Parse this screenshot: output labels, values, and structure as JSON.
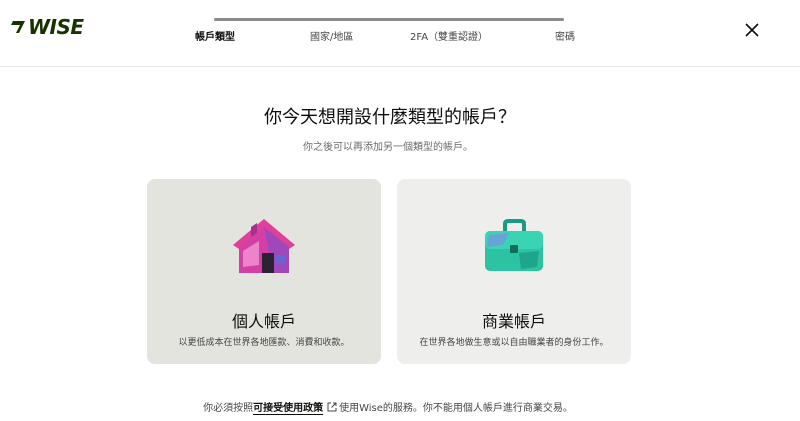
{
  "header": {
    "logo_text": "WISE",
    "steps": [
      {
        "label": "帳戶類型",
        "active": true
      },
      {
        "label": "國家/地區",
        "active": false
      },
      {
        "label": "2FA（雙重認證）",
        "active": false
      },
      {
        "label": "密碼",
        "active": false
      }
    ],
    "close_icon": "close-icon"
  },
  "main": {
    "title": "你今天想開設什麼類型的帳戶？",
    "subtitle": "你之後可以再添加另一個類型的帳戶。",
    "cards": [
      {
        "title": "個人帳戶",
        "description": "以更低成本在世界各地匯款、消費和收款。",
        "icon": "house-illustration"
      },
      {
        "title": "商業帳戶",
        "description": "在世界各地做生意或以自由職業者的身份工作。",
        "icon": "briefcase-illustration"
      }
    ]
  },
  "footer": {
    "text_before": "你必須按照",
    "link_text": "可接受使用政策",
    "text_after": "使用Wise的服務。你不能用個人帳戶進行商業交易。"
  },
  "colors": {
    "brand_dark": "#163300",
    "personal_card_bg": "#e2e4dd",
    "business_card_bg": "#eeefec"
  }
}
